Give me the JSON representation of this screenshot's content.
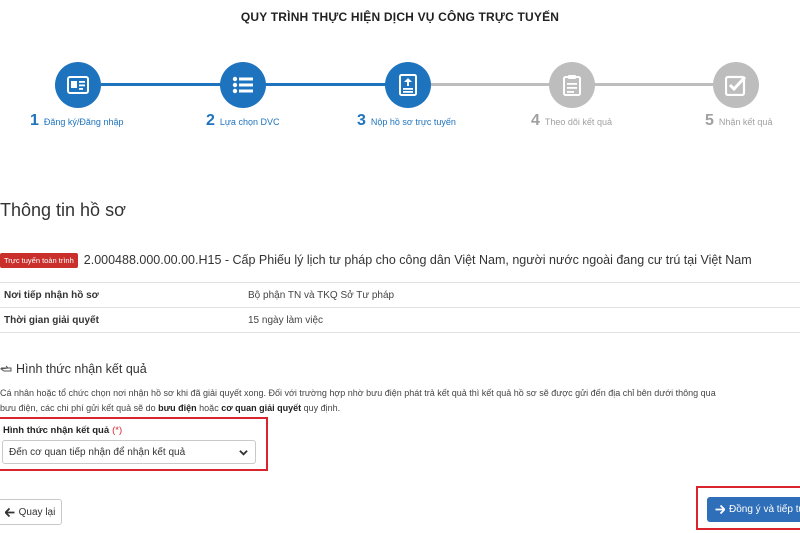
{
  "process": {
    "title": "QUY TRÌNH THỰC HIỆN DỊCH VỤ CÔNG TRỰC TUYẾN",
    "steps": [
      {
        "num": "1",
        "label": "Đăng ký/Đăng nhập",
        "icon": "id-card-icon",
        "state": "active"
      },
      {
        "num": "2",
        "label": "Lựa chọn DVC",
        "icon": "list-icon",
        "state": "active"
      },
      {
        "num": "3",
        "label": "Nộp hồ sơ trực tuyến",
        "icon": "document-upload-icon",
        "state": "active"
      },
      {
        "num": "4",
        "label": "Theo dõi kết quả",
        "icon": "clipboard-icon",
        "state": "inactive"
      },
      {
        "num": "5",
        "label": "Nhận kết quả",
        "icon": "checkbox-icon",
        "state": "inactive"
      }
    ]
  },
  "profile": {
    "title": "Thông tin hồ sơ",
    "badge": "Trực tuyến toàn trình",
    "procedure": "2.000488.000.00.00.H15 - Cấp Phiếu lý lịch tư pháp cho công dân Việt Nam, người nước ngoài đang cư trú tại Việt Nam",
    "rows": [
      {
        "label": "Nơi tiếp nhận hồ sơ",
        "value": "Bộ phận TN và TKQ Sở Tư pháp"
      },
      {
        "label": "Thời gian giải quyết",
        "value": "15 ngày làm việc"
      }
    ]
  },
  "receive": {
    "title": "Hình thức nhận kết quả",
    "desc_line1": "Cá nhân hoặc tổ chức chọn nơi nhận hồ sơ khi đã giải quyết xong. Đối với trường hợp nhờ bưu điện phát trả kết quả thì kết quả hồ sơ sẽ được gửi đến địa chỉ bên dưới thông qua",
    "desc_line2_a": "bưu điện, các chi phí gửi kết quả sẽ do ",
    "desc_line2_b": "bưu điện",
    "desc_line2_c": " hoặc ",
    "desc_line2_d": "cơ quan giải quyết",
    "desc_line2_e": " quy định.",
    "field_label": "Hình thức nhận kết quả",
    "required_mark": "(*)",
    "selected": "Đến cơ quan tiếp nhận để nhận kết quả"
  },
  "actions": {
    "back_label": "Quay lại",
    "next_label": "Đồng ý và tiếp tục"
  },
  "colors": {
    "primary": "#1e73be",
    "inactive": "#bdbdbd",
    "danger": "#d9232d",
    "button": "#2f6eb8"
  }
}
